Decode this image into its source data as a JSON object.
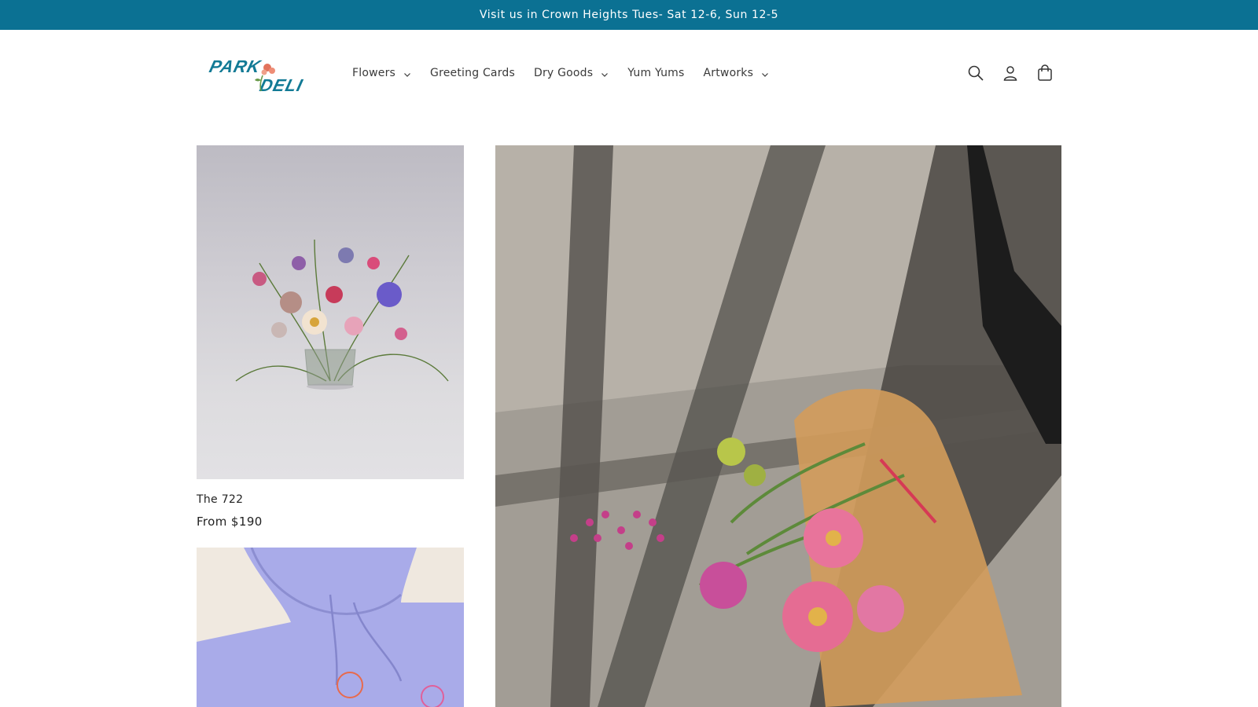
{
  "announcement": {
    "text": "Visit us in Crown Heights Tues- Sat 12-6, Sun 12-5"
  },
  "header": {
    "logo_text": [
      "PARK",
      "DELI"
    ],
    "nav": [
      {
        "label": "Flowers",
        "has_dropdown": true
      },
      {
        "label": "Greeting Cards",
        "has_dropdown": false
      },
      {
        "label": "Dry Goods",
        "has_dropdown": true
      },
      {
        "label": "Yum Yums",
        "has_dropdown": false
      },
      {
        "label": "Artworks",
        "has_dropdown": true
      }
    ],
    "icons": [
      "search-icon",
      "account-icon",
      "cart-icon"
    ]
  },
  "products": [
    {
      "title": "The 722",
      "price": "From $190"
    }
  ],
  "colors": {
    "announcement_bg": "#0b7193",
    "logo_teal": "#127a95",
    "logo_flower": "#e2735c"
  }
}
